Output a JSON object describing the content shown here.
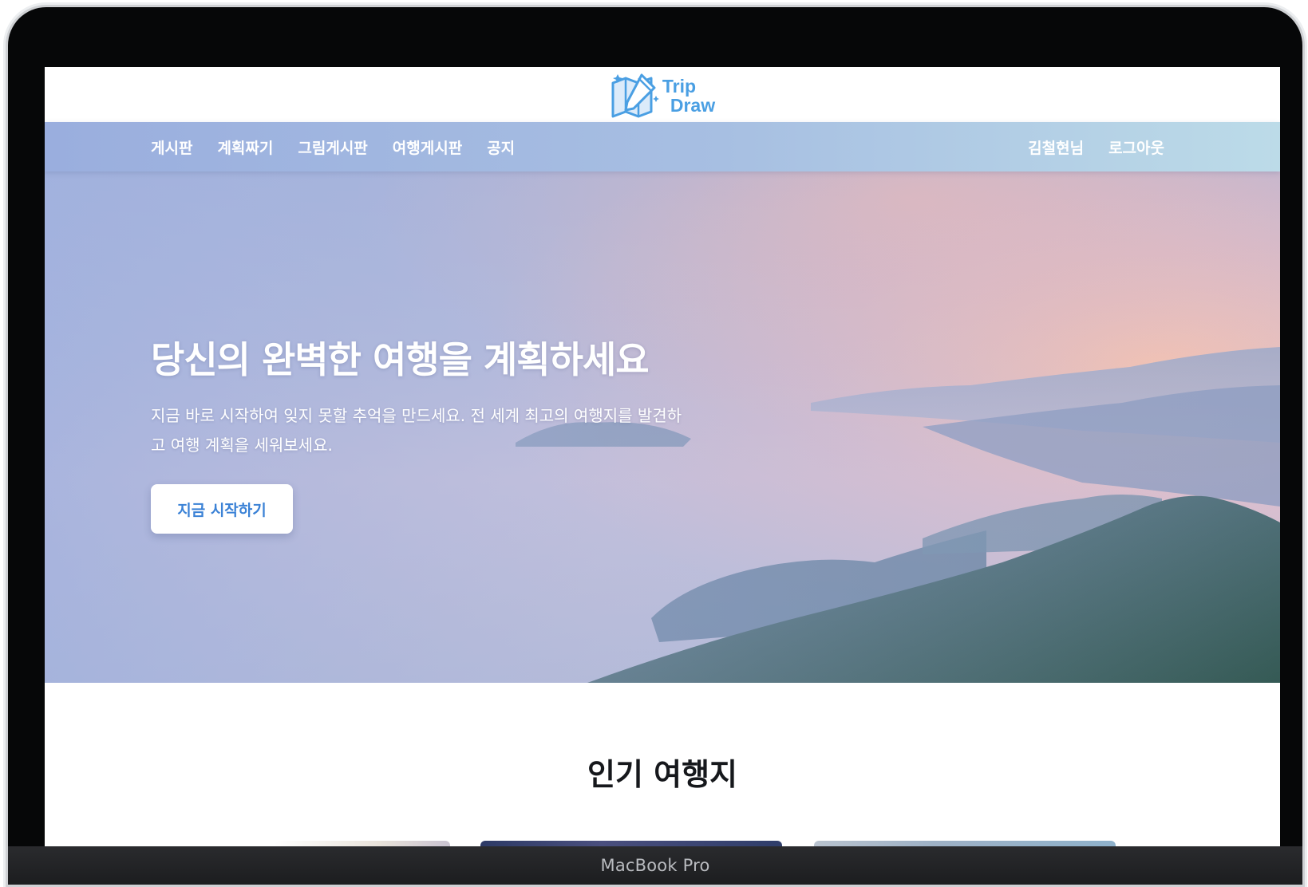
{
  "logo": {
    "line1": "Trip",
    "line2": "Draw"
  },
  "nav": {
    "left": [
      "게시판",
      "계획짜기",
      "그림게시판",
      "여행게시판",
      "공지"
    ],
    "right": [
      "김철현님",
      "로그아웃"
    ]
  },
  "hero": {
    "title": "당신의 완벽한 여행을 계획하세요",
    "subtitle": "지금 바로 시작하여 잊지 못할 추억을 만드세요. 전 세계 최고의 여행지를 발견하고 여행 계획을 세워보세요.",
    "cta": "지금 시작하기"
  },
  "popular": {
    "title": "인기 여행지"
  },
  "device": {
    "label": "MacBook Pro"
  },
  "colors": {
    "nav": "#a7bfe2",
    "accent": "#3b82d6",
    "logo": "#4a9fe3"
  }
}
